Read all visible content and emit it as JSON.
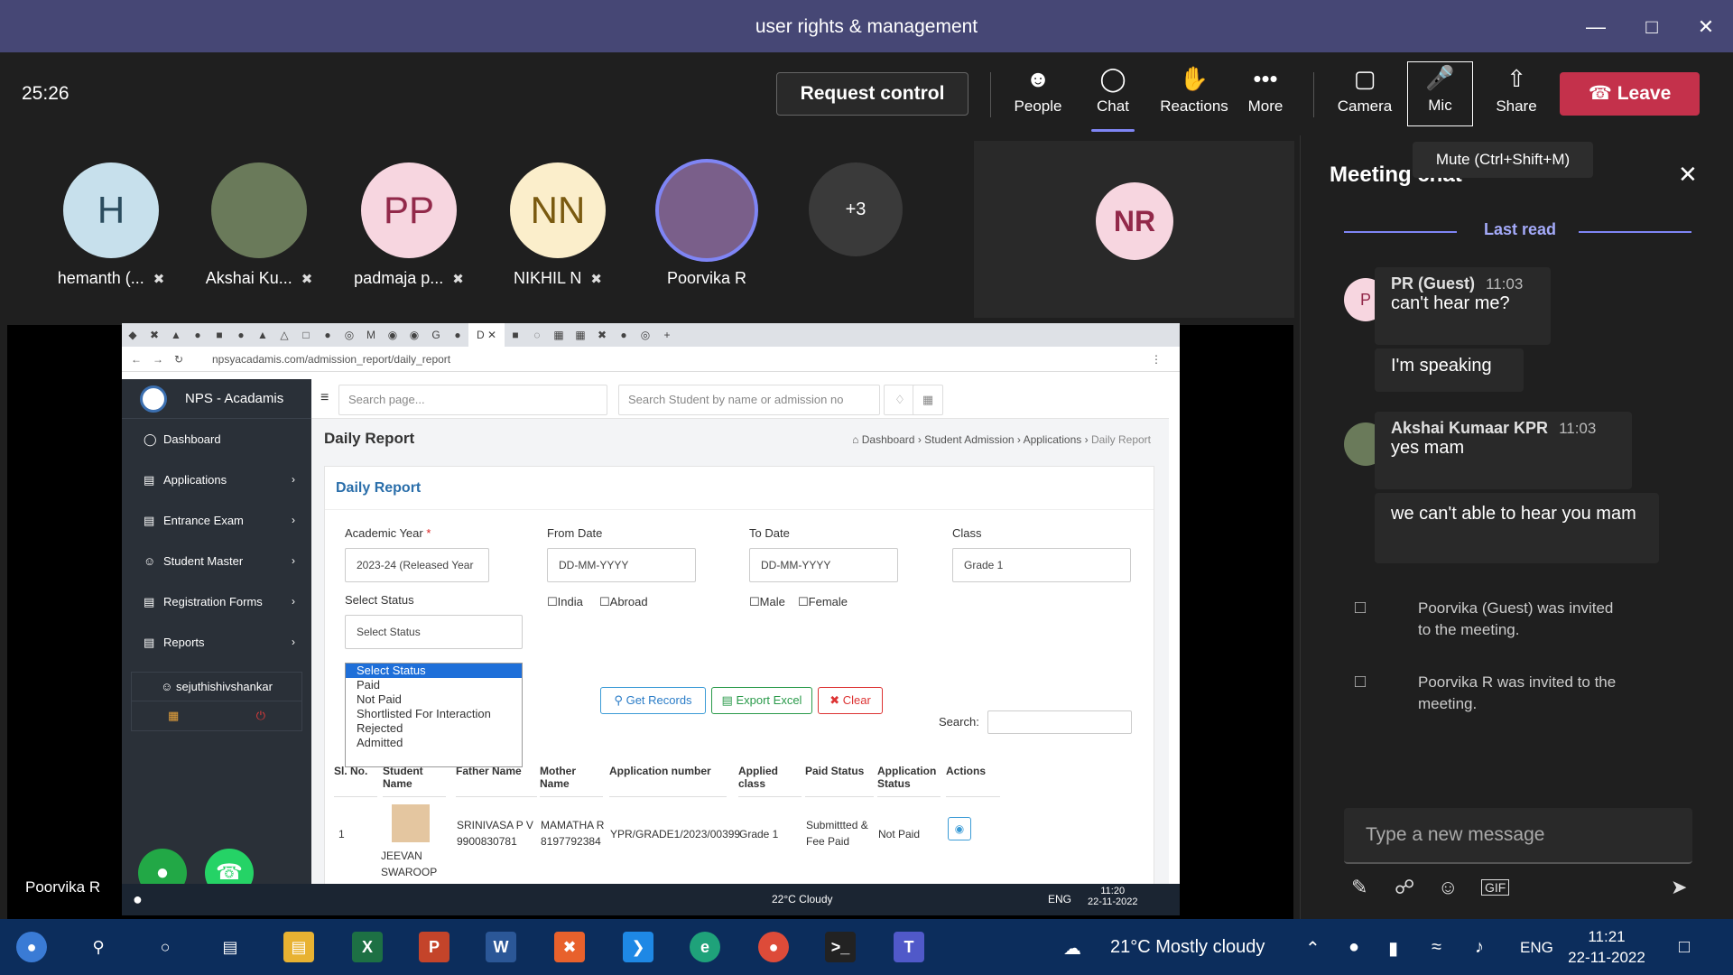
{
  "window": {
    "title": "user rights & management"
  },
  "meeting": {
    "timer": "25:26",
    "request_control": "Request control",
    "buttons": {
      "people": "People",
      "chat": "Chat",
      "reactions": "Reactions",
      "more": "More",
      "camera": "Camera",
      "mic": "Mic",
      "share": "Share"
    },
    "leave": "Leave",
    "tooltip": "Mute (Ctrl+Shift+M)",
    "participants": [
      {
        "initials": "H",
        "name": "hemanth (...",
        "muted": true,
        "color": "#c7e0ec"
      },
      {
        "initials": "",
        "name": "Akshai Ku...",
        "muted": true,
        "color": "#6a7a5a"
      },
      {
        "initials": "PP",
        "name": "padmaja p...",
        "muted": true,
        "color": "#f7d6e0"
      },
      {
        "initials": "NN",
        "name": "NIKHIL N",
        "muted": true,
        "color": "#fbeecb"
      },
      {
        "initials": "",
        "name": "Poorvika R",
        "muted": false,
        "color": "#7a5f8a"
      },
      {
        "initials": "+3",
        "name": "",
        "muted": false,
        "color": "#3a3a3a"
      }
    ],
    "spotlight": {
      "initials": "NR"
    },
    "presenter": "Poorvika R"
  },
  "browser": {
    "url": "npsyacadamis.com/admission_report/daily_report",
    "brand": "NPS - Acadamis",
    "nav": [
      "Dashboard",
      "Applications",
      "Entrance Exam",
      "Student Master",
      "Registration Forms",
      "Reports"
    ],
    "user": "sejuthishivshankar",
    "search_page": "Search page...",
    "search_student": "Search Student by name or admission no",
    "page_title": "Daily Report",
    "breadcrumbs": [
      "Dashboard",
      "Student Admission",
      "Applications",
      "Daily Report"
    ],
    "card_title": "Daily Report",
    "form": {
      "academic_year_label": "Academic Year",
      "academic_year_value": "2023-24 (Released Year",
      "from_date_label": "From Date",
      "from_date_value": "DD-MM-YYYY",
      "to_date_label": "To Date",
      "to_date_value": "DD-MM-YYYY",
      "class_label": "Class",
      "class_value": "Grade 1",
      "status_label": "Select Status",
      "status_value": "Select Status",
      "india": "India",
      "abroad": "Abroad",
      "male": "Male",
      "female": "Female"
    },
    "status_options": [
      "Select Status",
      "Paid",
      "Not Paid",
      "Shortlisted For Interaction",
      "Rejected",
      "Admitted"
    ],
    "buttons": {
      "get": "Get Records",
      "export": "Export Excel",
      "clear": "Clear"
    },
    "search_label": "Search:",
    "columns": [
      "Sl. No.",
      "Student Name",
      "Father Name",
      "Mother Name",
      "Application number",
      "Applied class",
      "Paid Status",
      "Application Status",
      "Actions"
    ],
    "row": {
      "sl": "1",
      "student": "JEEVAN SWAROOP S",
      "father": "SRINIVASA P V 9900830781",
      "mother": "MAMATHA R 8197792384",
      "app_no": "YPR/GRADE1/2023/00399",
      "class": "Grade 1",
      "paid": "Submittted & Fee Paid",
      "status": "Not Paid"
    },
    "mini_taskbar": {
      "weather": "22°C Cloudy",
      "lang": "ENG",
      "time": "11:20",
      "date": "22-11-2022"
    }
  },
  "chat": {
    "title": "Meeting chat",
    "last_read": "Last read",
    "messages": [
      {
        "initial": "P",
        "sender": "PR (Guest)",
        "time": "11:03",
        "lines": [
          "can't hear me?",
          "I'm speaking"
        ]
      },
      {
        "initial": "",
        "sender": "Akshai Kumaar KPR",
        "time": "11:03",
        "lines": [
          "yes mam",
          "we can't able to hear you mam"
        ]
      }
    ],
    "system": [
      "Poorvika (Guest) was invited to the meeting.",
      "Poorvika R was invited to the meeting."
    ],
    "placeholder": "Type a new message"
  },
  "taskbar": {
    "weather": "21°C  Mostly cloudy",
    "lang": "ENG",
    "time": "11:21",
    "date": "22-11-2022"
  }
}
